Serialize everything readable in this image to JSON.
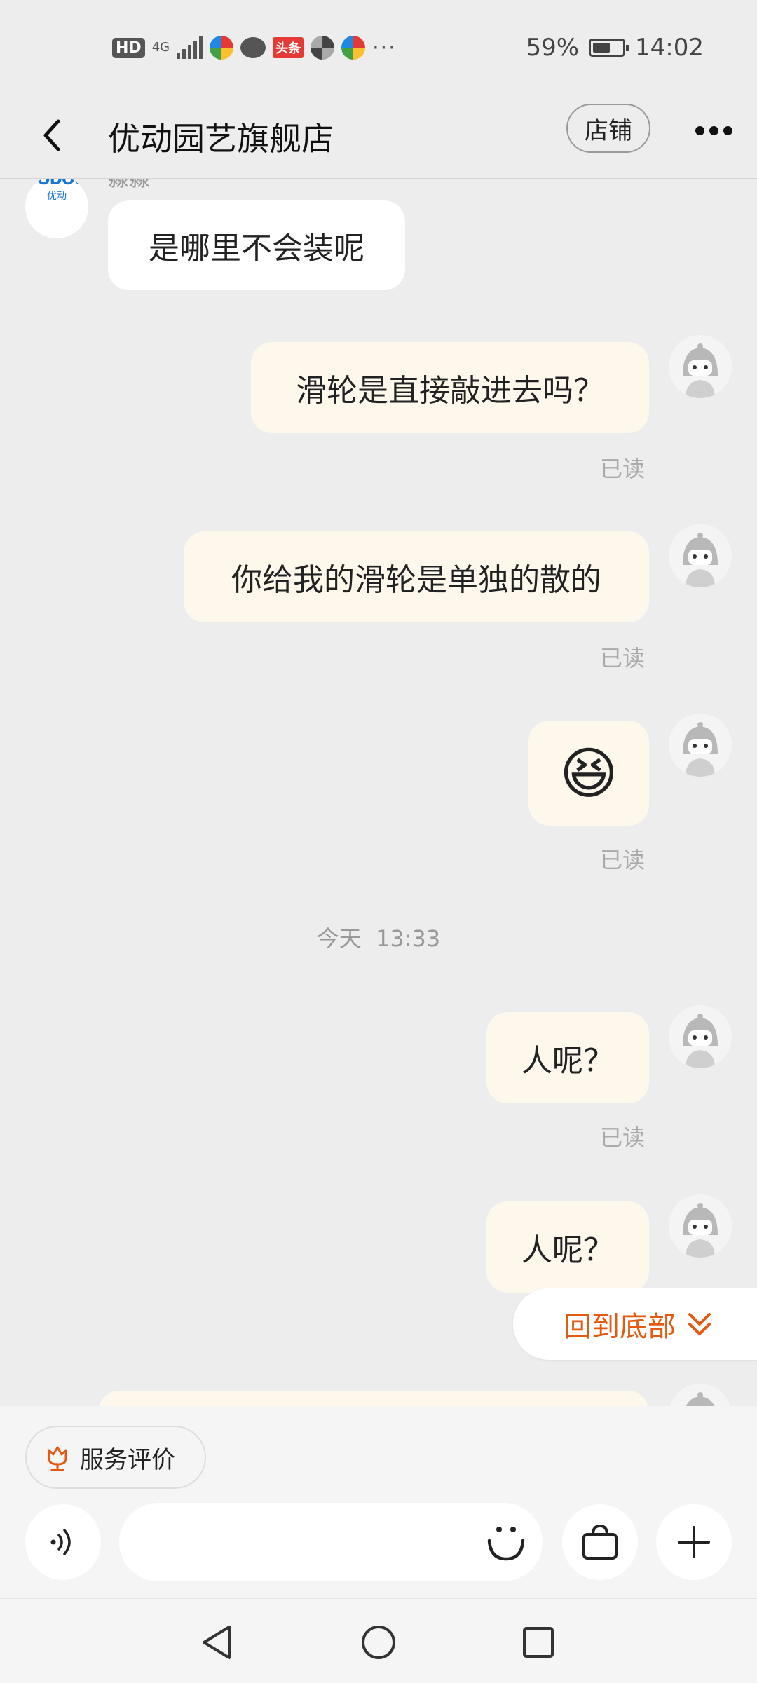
{
  "status_bar": {
    "hd": "HD",
    "network": "4G",
    "toutiao": "头条",
    "more": "···",
    "battery": "59%",
    "battery_level": 0.59,
    "time": "14:02"
  },
  "header": {
    "title": "优动园艺旗舰店",
    "store_button": "店铺"
  },
  "shop": {
    "logo_en": "YODOO",
    "logo_cn": "优动",
    "sender_name_peek": "淼淼"
  },
  "messages": [
    {
      "side": "left",
      "text": "是哪里不会装呢"
    },
    {
      "side": "right",
      "text": "滑轮是直接敲进去吗？",
      "status": "已读"
    },
    {
      "side": "right",
      "text": "你给我的滑轮是单独的散的",
      "status": "已读"
    },
    {
      "side": "right",
      "emoji": "😆",
      "status": "已读"
    },
    {
      "timestamp": "今天  13:33"
    },
    {
      "side": "right",
      "text": "人呢？",
      "status": "已读"
    },
    {
      "side": "right",
      "text": "人呢？"
    }
  ],
  "back_to_bottom": "回到底部",
  "bottom_panel": {
    "rate_button": "服务评价",
    "input_placeholder": ""
  },
  "colors": {
    "background": "#ededed",
    "my_bubble": "#fdf7ec",
    "their_bubble": "#ffffff",
    "accent": "#e35b12"
  }
}
